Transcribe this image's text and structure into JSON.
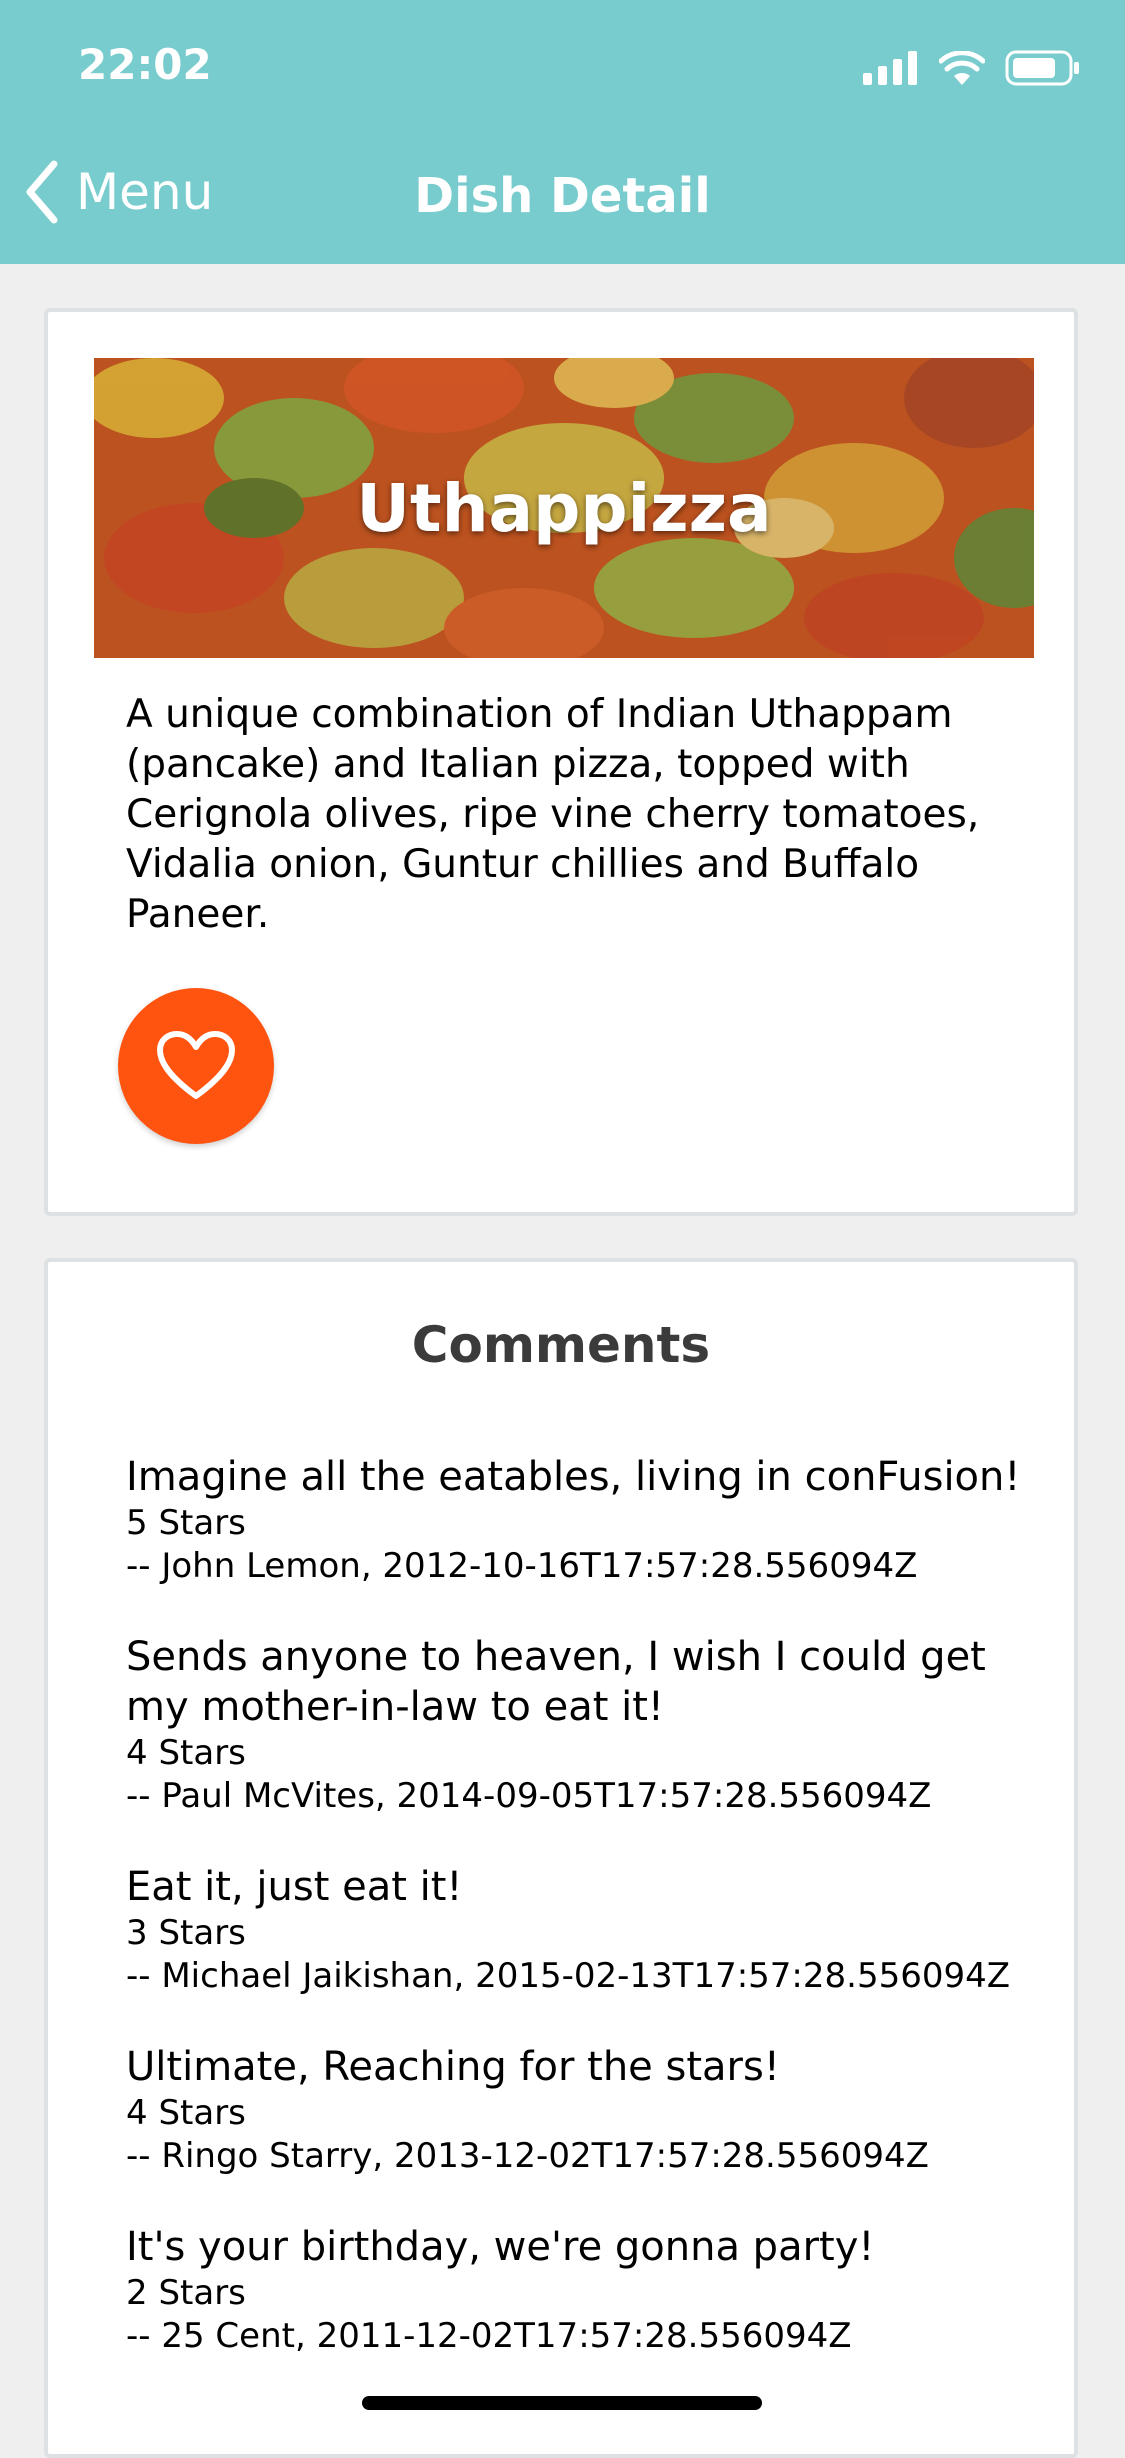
{
  "status_bar": {
    "time": "22:02"
  },
  "nav": {
    "back_label": "Menu",
    "title": "Dish Detail"
  },
  "dish": {
    "name": "Uthappizza",
    "description": "A unique combination of Indian Uthappam (pancake) and Italian pizza, topped with Cerignola olives, ripe vine cherry tomatoes, Vidalia onion, Guntur chillies and Buffalo Paneer.",
    "favorite_icon": "heart-outline-icon",
    "favorite_color": "#ff5310"
  },
  "comments": {
    "title": "Comments",
    "items": [
      {
        "text": "Imagine all the eatables, living in conFusion!",
        "stars": "5 Stars",
        "meta": "-- John Lemon, 2012-10-16T17:57:28.556094Z"
      },
      {
        "text": "Sends anyone to heaven, I wish I could get my mother-in-law to eat it!",
        "stars": "4 Stars",
        "meta": "-- Paul McVites, 2014-09-05T17:57:28.556094Z"
      },
      {
        "text": "Eat it, just eat it!",
        "stars": "3 Stars",
        "meta": "-- Michael Jaikishan, 2015-02-13T17:57:28.556094Z"
      },
      {
        "text": "Ultimate, Reaching for the stars!",
        "stars": "4 Stars",
        "meta": "-- Ringo Starry, 2013-12-02T17:57:28.556094Z"
      },
      {
        "text": "It's your birthday, we're gonna party!",
        "stars": "2 Stars",
        "meta": "-- 25 Cent, 2011-12-02T17:57:28.556094Z"
      }
    ]
  },
  "theme": {
    "header_bg": "#79cccd",
    "page_bg": "#efefef"
  }
}
